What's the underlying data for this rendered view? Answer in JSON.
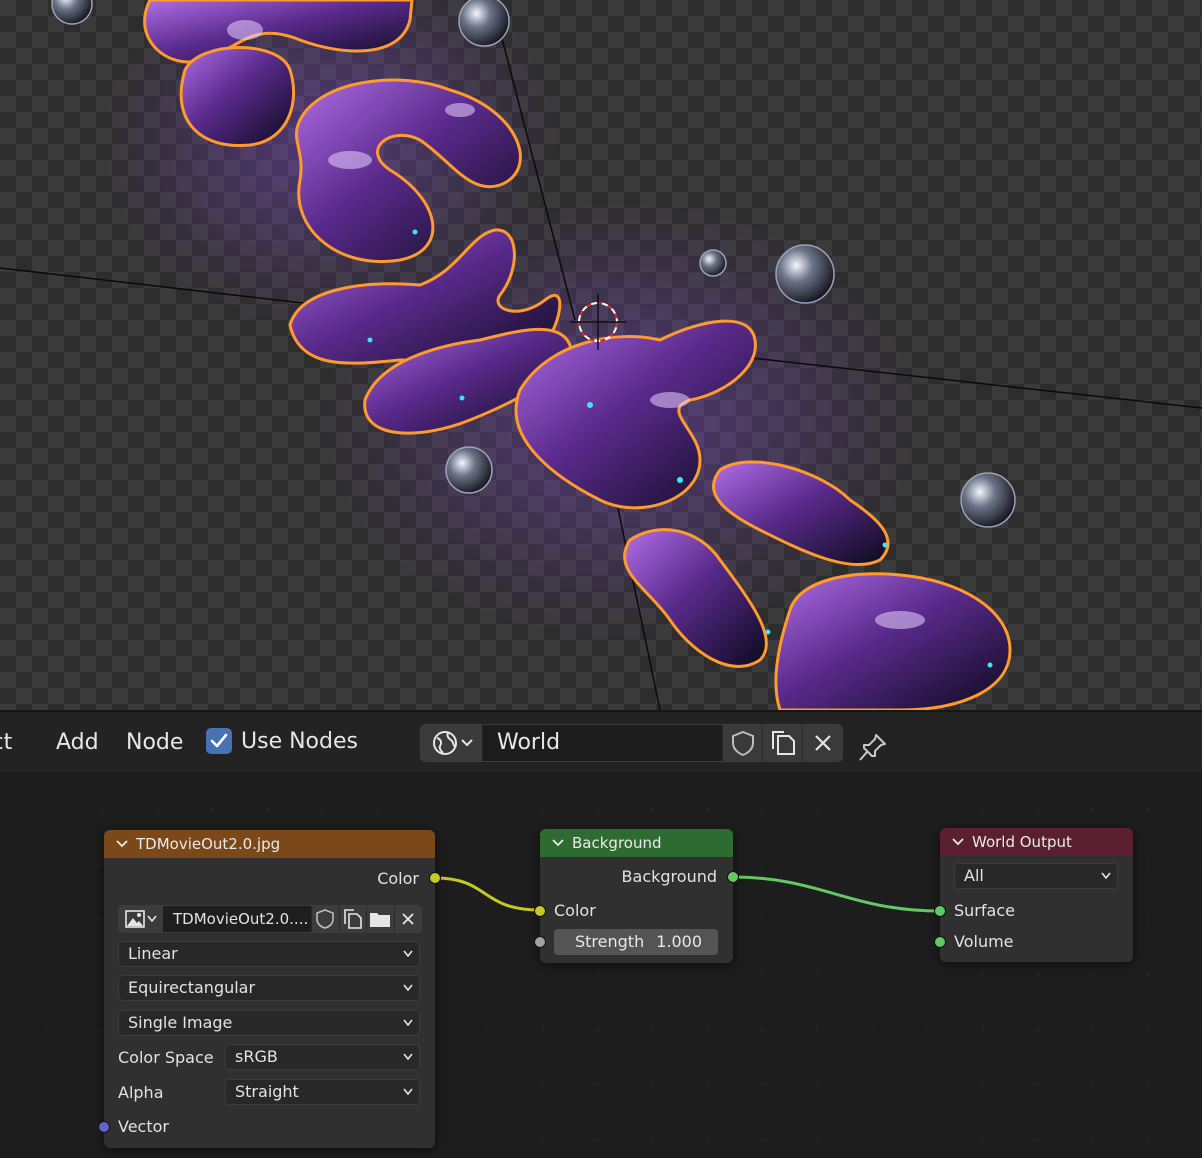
{
  "header": {
    "menu": [
      "ect",
      "Add",
      "Node"
    ],
    "use_nodes_label": "Use Nodes",
    "use_nodes_checked": true,
    "world_name": "World",
    "icons": [
      "world-icon",
      "chevron-down-icon",
      "fake-user-shield-icon",
      "duplicate-icon",
      "close-icon",
      "pin-icon"
    ]
  },
  "nodes": {
    "image": {
      "title": "TDMovieOut2.0.jpg",
      "output_color": "Color",
      "image_name": "TDMovieOut2.0....",
      "interpolation": "Linear",
      "projection": "Equirectangular",
      "source": "Single Image",
      "color_space_label": "Color Space",
      "color_space": "sRGB",
      "alpha_label": "Alpha",
      "alpha": "Straight",
      "input_vector": "Vector",
      "header_color": "#7a4819"
    },
    "background": {
      "title": "Background",
      "output": "Background",
      "input_color": "Color",
      "strength_label": "Strength",
      "strength_value": "1.000",
      "header_color": "#2e6b31"
    },
    "world_output": {
      "title": "World Output",
      "target": "All",
      "input_surface": "Surface",
      "input_volume": "Volume",
      "header_color": "#5a2030"
    }
  },
  "colors": {
    "accent": "#4772b3",
    "socket_color": "#c7c729",
    "socket_shader": "#63c763",
    "socket_float": "#a1a1a1",
    "socket_vector": "#6363c7",
    "selection_outline": "#ff9a2e"
  }
}
